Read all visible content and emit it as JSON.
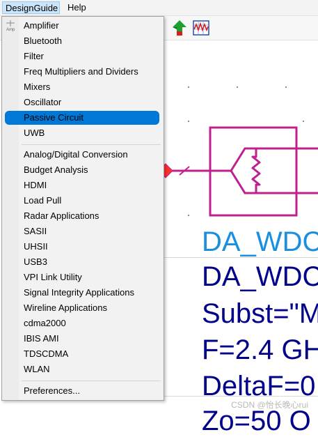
{
  "menubar": {
    "items": [
      {
        "label": "DesignGuide",
        "active": true
      },
      {
        "label": "Help",
        "active": false
      }
    ]
  },
  "menu": {
    "tiny_icon_label": "Amp",
    "groups": [
      [
        "Amplifier",
        "Bluetooth",
        "Filter",
        "Freq Multipliers and Dividers",
        "Mixers",
        "Oscillator",
        "Passive Circuit",
        "UWB"
      ],
      [
        "Analog/Digital Conversion",
        "Budget Analysis",
        "HDMI",
        "Load Pull",
        "Radar Applications",
        "SASII",
        "UHSII",
        "USB3",
        "VPI Link Utility",
        "Signal Integrity Applications",
        "Wireline Applications",
        "cdma2000",
        "IBIS AMI",
        "TDSCDMA",
        "WLAN"
      ],
      [
        "Preferences..."
      ]
    ],
    "highlighted": "Passive Circuit",
    "highlight_color": "#0078d7"
  },
  "schematic": {
    "component_color": "#c0208f",
    "wire_color": "#c0208f",
    "text_blue": "#1a8fe0",
    "text_navy": "#00008b",
    "lines": [
      "DA_WDC",
      "DA_WDC",
      "Subst=\"M",
      "F=2.4 GH",
      "DeltaF=0",
      "Zo=50 O"
    ]
  },
  "watermark": "CSDN @怡长晚心rui",
  "toolbar": {
    "icons": [
      "up-arrow-tree-icon",
      "waveform-grid-icon"
    ]
  }
}
